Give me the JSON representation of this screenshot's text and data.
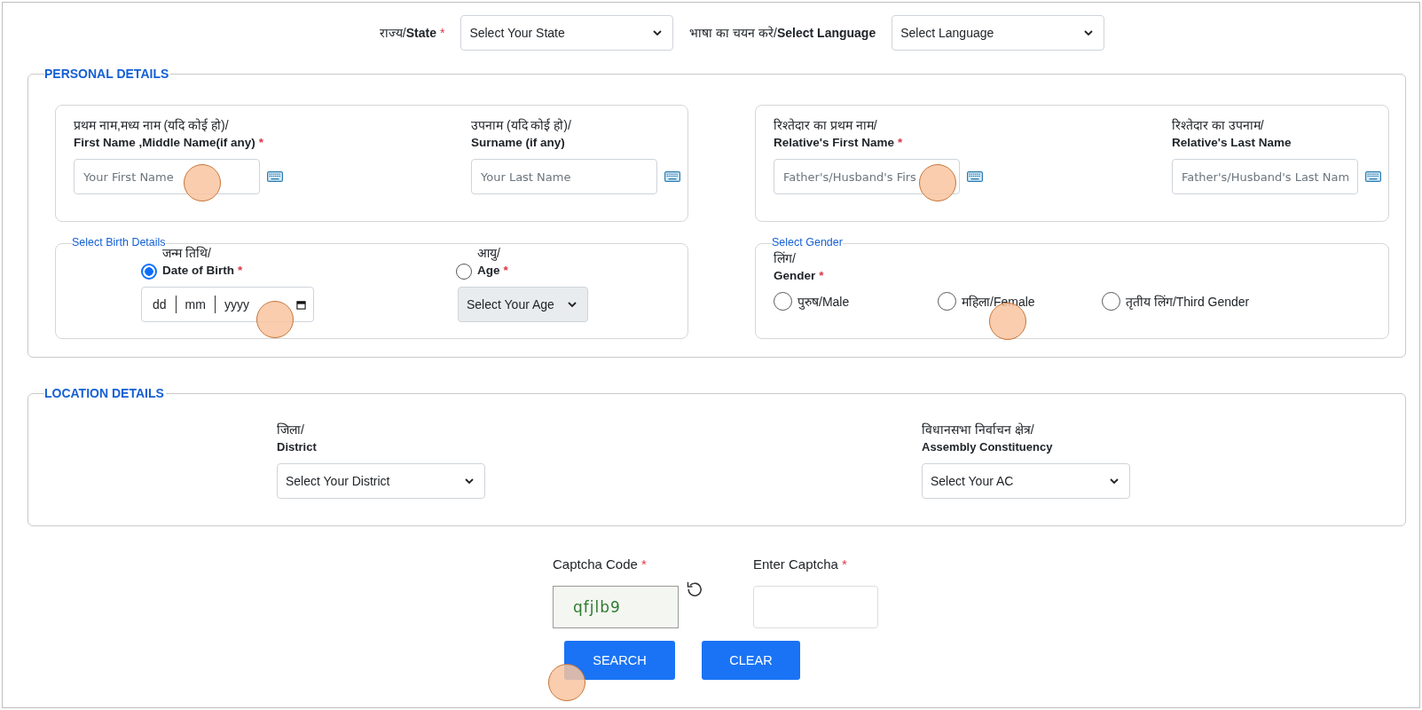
{
  "top_bar": [
    {
      "label": "राज्य/",
      "label_bold": "State",
      "required_mark": "*",
      "value": "Select Your State"
    },
    {
      "label": "भाषा का चयन करे/",
      "label_bold": "Select Language",
      "value": "Select Language"
    }
  ],
  "personal_details": {
    "legend": "PERSONAL DETAILS",
    "name_groups": [
      [
        {
          "label": "प्रथम नाम,मध्य नाम (यदि कोई हो)/",
          "label_bold": "First Name ,Middle Name(if any)",
          "required_mark": "*",
          "placeholder": "Your First Name"
        },
        {
          "label": "उपनाम (यदि कोई हो)/",
          "label_bold": "Surname (if any)",
          "placeholder": "Your Last Name"
        }
      ],
      [
        {
          "label": "रिश्तेदार का प्रथम नाम/",
          "label_bold": "Relative's First Name",
          "required_mark": "*",
          "placeholder": "Father's/Husband's Firs"
        },
        {
          "label": "रिश्तेदार का उपनाम/",
          "label_bold": "Relative's Last Name",
          "placeholder": "Father's/Husband's Last Nam"
        }
      ]
    ],
    "birth": {
      "legend": "Select Birth Details",
      "options": [
        {
          "kind": "date",
          "label": "जन्म तिथि/",
          "label_bold": "Date of Birth",
          "required_mark": "*",
          "selected": true,
          "parts": [
            "dd",
            "mm",
            "yyyy"
          ]
        },
        {
          "kind": "select",
          "label": "आयु/",
          "label_bold": "Age",
          "required_mark": "*",
          "selected": false,
          "value": "Select Your Age",
          "disabled": true
        }
      ]
    },
    "gender": {
      "legend": "Select Gender",
      "label": "लिंग/",
      "label_bold": "Gender",
      "required_mark": "*",
      "options": [
        {
          "label": "पुरुष/Male",
          "selected": false
        },
        {
          "label": "महिला/Female",
          "selected": false
        },
        {
          "label": "तृतीय लिंग/Third Gender",
          "selected": false
        }
      ]
    }
  },
  "location_details": {
    "legend": "LOCATION DETAILS",
    "fields": [
      {
        "label": "जिला/",
        "label_bold": "District",
        "value": "Select Your District"
      },
      {
        "label": "विधानसभा निर्वाचन क्षेत्र/",
        "label_bold": "Assembly Constituency",
        "value": "Select Your AC"
      }
    ]
  },
  "captcha": {
    "code_label": "Captcha Code",
    "code_required_mark": "*",
    "code": "qfjlb9",
    "input_label": "Enter Captcha",
    "input_required_mark": "*"
  },
  "buttons": [
    "SEARCH",
    "CLEAR"
  ]
}
